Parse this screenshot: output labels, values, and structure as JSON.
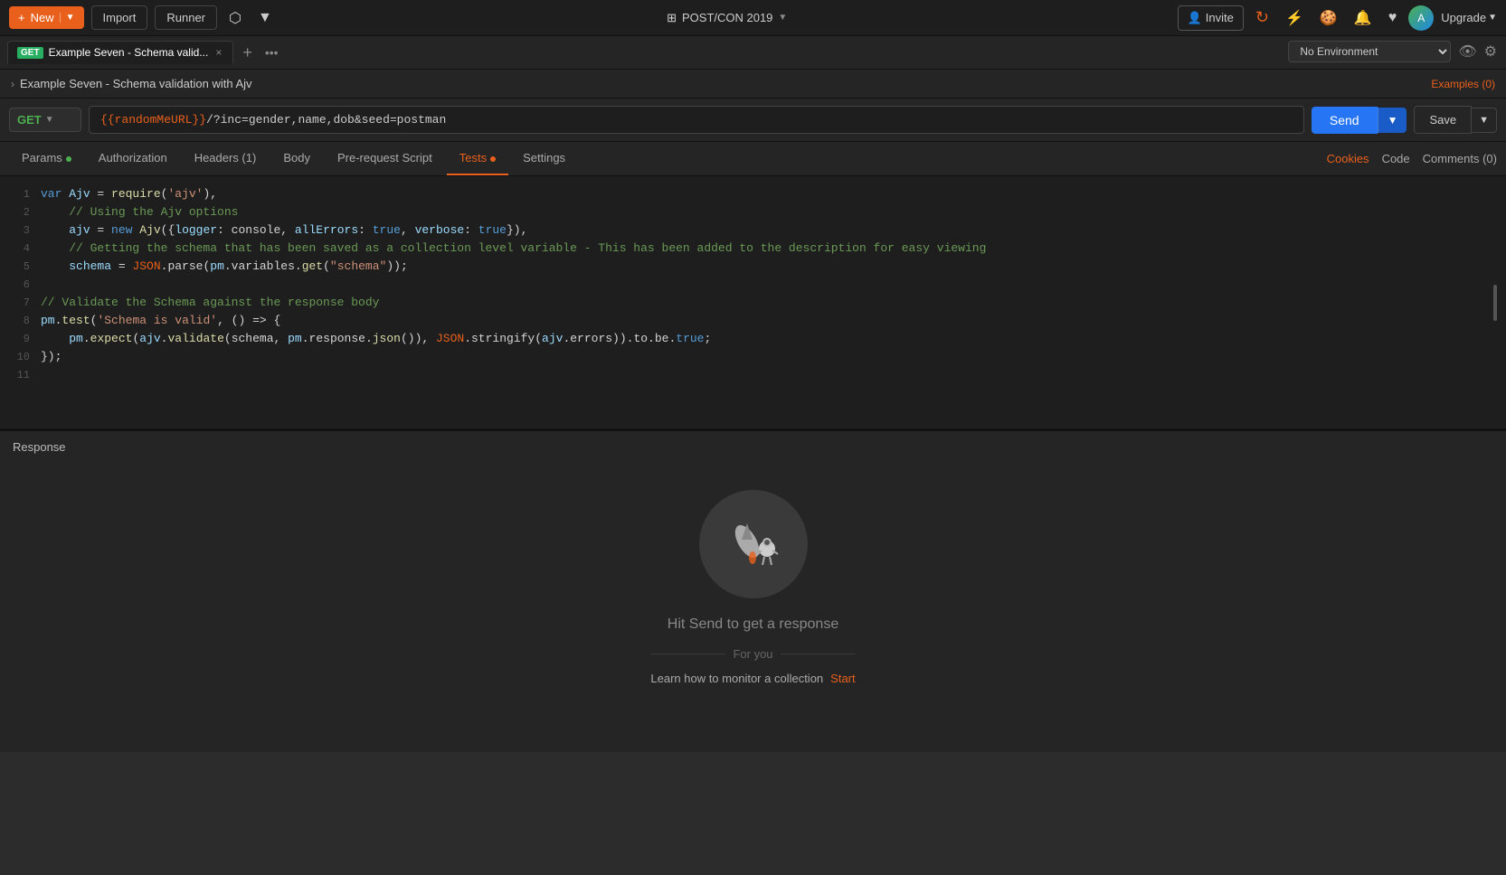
{
  "toolbar": {
    "new_label": "New",
    "import_label": "Import",
    "runner_label": "Runner",
    "workspace_name": "POST/CON 2019",
    "invite_label": "Invite",
    "upgrade_label": "Upgrade"
  },
  "tabs": [
    {
      "method": "GET",
      "title": "Example Seven - Schema valid...",
      "active": true
    }
  ],
  "env_bar": {
    "no_environment": "No Environment"
  },
  "breadcrumb": {
    "title": "Example Seven - Schema validation with Ajv",
    "examples_label": "Examples (0)"
  },
  "request": {
    "method": "GET",
    "url": "{{randomMeURL}}/?inc=gender,name,dob&seed=postman",
    "send_label": "Send",
    "save_label": "Save"
  },
  "request_tabs": {
    "params": "Params",
    "authorization": "Authorization",
    "headers": "Headers (1)",
    "body": "Body",
    "pre_request": "Pre-request Script",
    "tests": "Tests",
    "settings": "Settings",
    "cookies": "Cookies",
    "code": "Code",
    "comments": "Comments (0)"
  },
  "code_lines": [
    {
      "num": 1,
      "content": "var Ajv = require('ajv'),"
    },
    {
      "num": 2,
      "content": "    // Using the Ajv options"
    },
    {
      "num": 3,
      "content": "    ajv = new Ajv({logger: console, allErrors: true, verbose: true}),"
    },
    {
      "num": 4,
      "content": "    // Getting the schema that has been saved as a collection level variable - This has been added to the description for easy viewing"
    },
    {
      "num": 5,
      "content": "    schema = JSON.parse(pm.variables.get(\"schema\"));"
    },
    {
      "num": 6,
      "content": ""
    },
    {
      "num": 7,
      "content": "// Validate the Schema against the response body"
    },
    {
      "num": 8,
      "content": "pm.test('Schema is valid', () => {"
    },
    {
      "num": 9,
      "content": "    pm.expect(ajv.validate(schema, pm.response.json()), JSON.stringify(ajv.errors)).to.be.true;"
    },
    {
      "num": 10,
      "content": "});"
    },
    {
      "num": 11,
      "content": ""
    }
  ],
  "response": {
    "title": "Response",
    "hit_send_text": "Hit Send to get a response",
    "for_you_label": "For you",
    "learn_label": "Learn how to monitor a collection",
    "start_label": "Start"
  }
}
